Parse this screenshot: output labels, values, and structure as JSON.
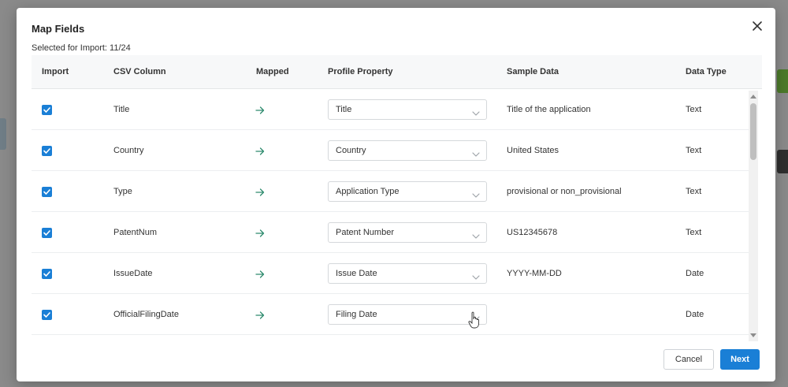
{
  "modal": {
    "title": "Map Fields",
    "subtitle": "Selected for Import: 11/24"
  },
  "table": {
    "headers": {
      "import": "Import",
      "csv_column": "CSV Column",
      "mapped": "Mapped",
      "profile_property": "Profile Property",
      "sample_data": "Sample Data",
      "data_type": "Data Type"
    },
    "rows": [
      {
        "checked": true,
        "csv_column": "Title",
        "profile_property": "Title",
        "sample_data": "Title of the application",
        "data_type": "Text"
      },
      {
        "checked": true,
        "csv_column": "Country",
        "profile_property": "Country",
        "sample_data": "United States",
        "data_type": "Text"
      },
      {
        "checked": true,
        "csv_column": "Type",
        "profile_property": "Application Type",
        "sample_data": "provisional or non_provisional",
        "data_type": "Text"
      },
      {
        "checked": true,
        "csv_column": "PatentNum",
        "profile_property": "Patent Number",
        "sample_data": "US12345678",
        "data_type": "Text"
      },
      {
        "checked": true,
        "csv_column": "IssueDate",
        "profile_property": "Issue Date",
        "sample_data": "YYYY-MM-DD",
        "data_type": "Date"
      },
      {
        "checked": true,
        "csv_column": "OfficialFilingDate",
        "profile_property": "Filing Date",
        "sample_data": "",
        "data_type": "Date"
      }
    ]
  },
  "footer": {
    "cancel_label": "Cancel",
    "next_label": "Next"
  },
  "colors": {
    "accent": "#1a7fd6",
    "mapped_arrow": "#2e8b6e"
  },
  "icons": {
    "close": "close-icon",
    "checkbox": "check-icon",
    "mapped": "arrow-right-icon",
    "select": "chevron-down-icon"
  }
}
